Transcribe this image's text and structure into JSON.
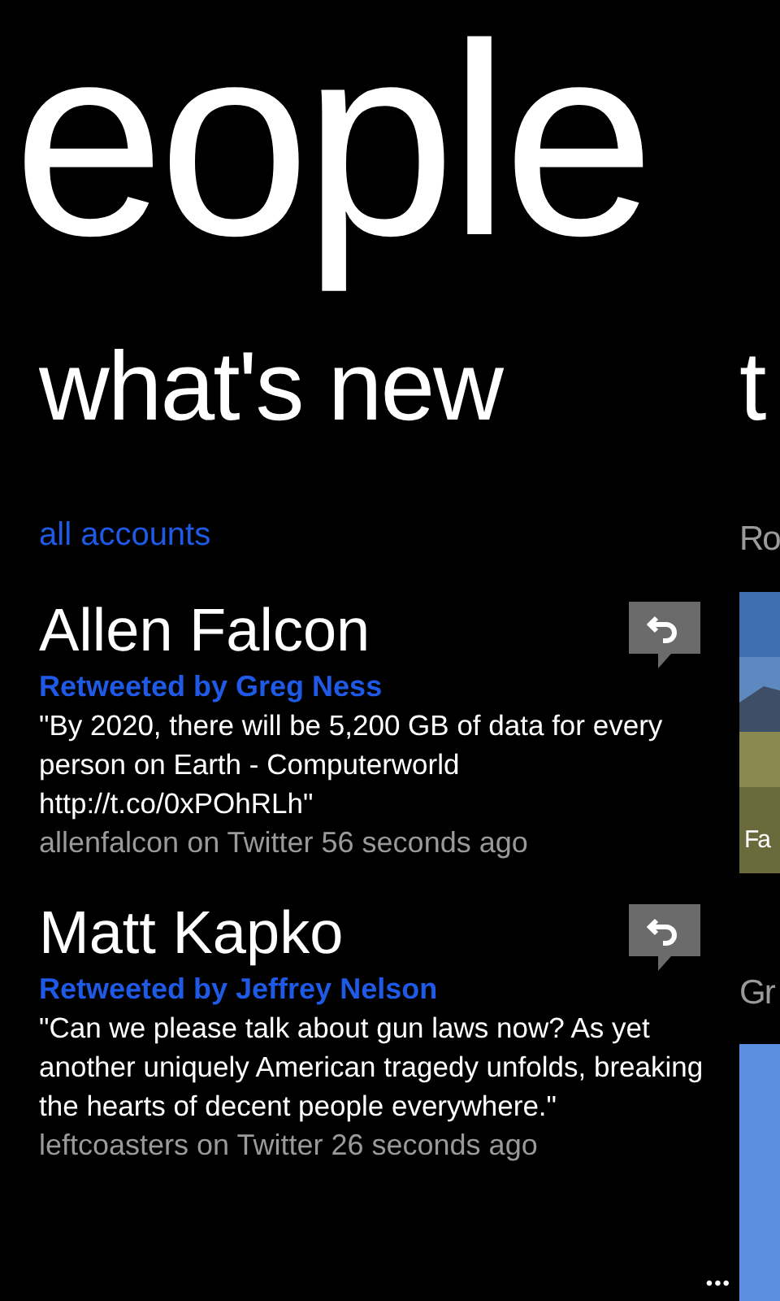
{
  "hub_title": "eople",
  "sections": [
    {
      "title": "what's new"
    },
    {
      "title": "t"
    }
  ],
  "filter": "all accounts",
  "feed": [
    {
      "name": "Allen Falcon",
      "retweeted_by": "Retweeted by Greg Ness",
      "text": "\"By 2020, there will be 5,200 GB of data for every person on Earth - Computerworld http://t.co/0xPOhRLh\"",
      "meta": "allenfalcon on Twitter 56 seconds ago"
    },
    {
      "name": "Matt Kapko",
      "retweeted_by": "Retweeted by Jeffrey Nelson",
      "text": "\"Can we please talk about gun laws now? As yet another uniquely American tragedy unfolds, breaking the hearts of decent people everywhere.\"",
      "meta": "leftcoasters on Twitter 26 seconds ago"
    }
  ],
  "side_items": [
    {
      "label": "Ro",
      "tile": {
        "kind": "picture",
        "caption": "Fa"
      }
    },
    {
      "label": "Gr",
      "tile": {
        "kind": "plain"
      }
    }
  ],
  "app_bar": {
    "more": "•••"
  }
}
